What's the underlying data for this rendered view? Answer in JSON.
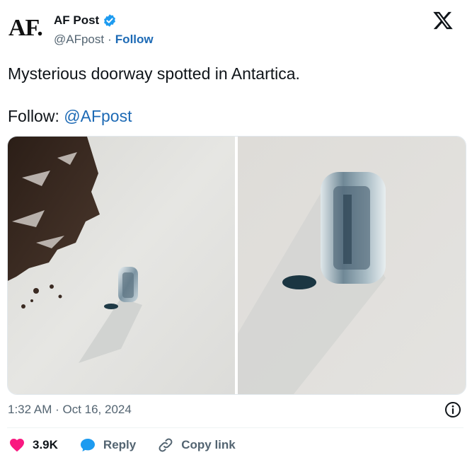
{
  "author": {
    "avatar_text": "AF.",
    "display_name": "AF Post",
    "handle": "@AFpost",
    "separator": "·",
    "follow_label": "Follow",
    "verified_icon": "verified-badge-icon"
  },
  "tweet": {
    "text": "Mysterious doorway spotted in Antartica.",
    "follow_prefix": "Follow: ",
    "mention": "@AFpost",
    "timestamp": "1:32 AM · Oct 16, 2024"
  },
  "actions": {
    "like_count": "3.9K",
    "reply_label": "Reply",
    "copy_link_label": "Copy link"
  },
  "colors": {
    "link": "#1d6ab5",
    "like": "#f91880",
    "reply": "#1d9bf0",
    "verified": "#1d9bf0",
    "muted": "#536471"
  }
}
